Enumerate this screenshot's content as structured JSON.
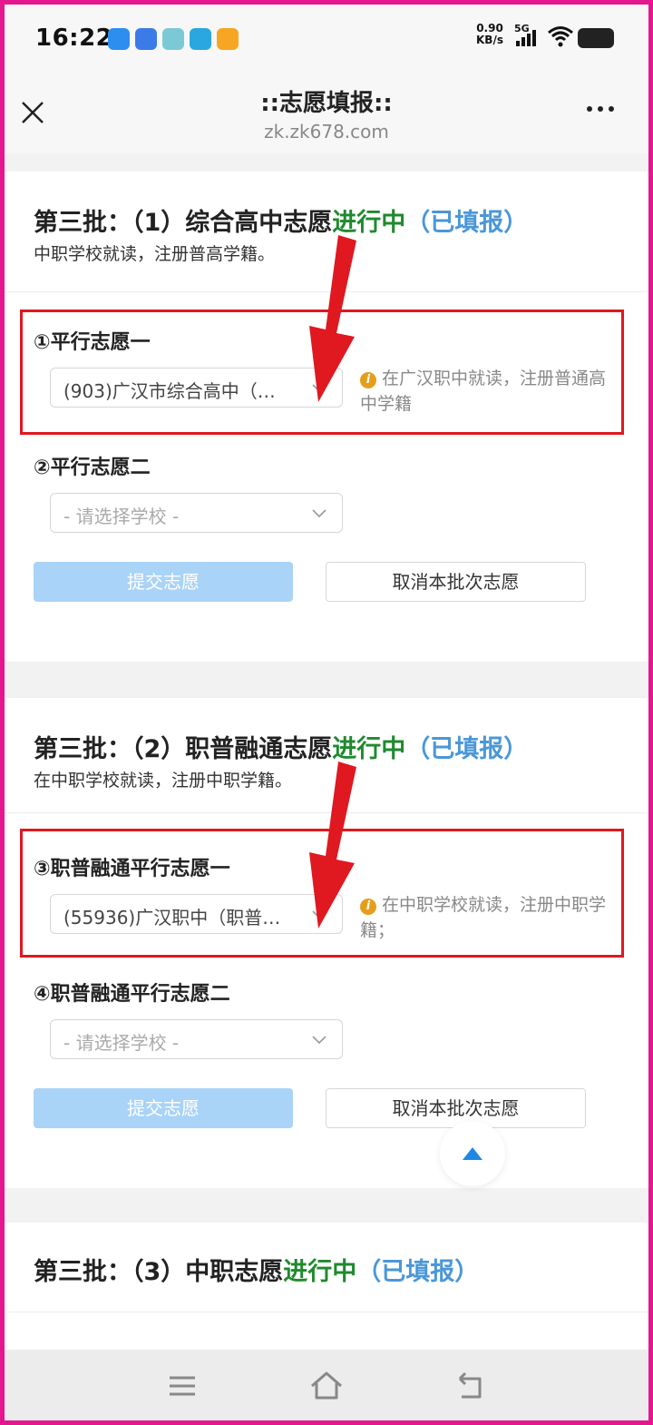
{
  "status": {
    "time": "16:22",
    "net_speed_value": "0.90",
    "net_speed_unit": "KB/s",
    "network": "5G",
    "app_icons": [
      {
        "name": "browser-app-icon",
        "color": "#2d8ef0"
      },
      {
        "name": "photo-app-icon",
        "color": "#3a7be8"
      },
      {
        "name": "gallery-app-icon",
        "color": "#7cc9d6"
      },
      {
        "name": "telegram-app-icon",
        "color": "#2aa7df"
      },
      {
        "name": "video-app-icon",
        "color": "#f6a623"
      }
    ]
  },
  "header": {
    "title": "::志愿填报::",
    "url": "zk.zk678.com"
  },
  "sections": [
    {
      "title": "第三批：（1）综合高中志愿",
      "status": "进行中",
      "filled": "（已填报）",
      "subtitle": "中职学校就读，注册普高学籍。",
      "field1_label": "①平行志愿一",
      "field1_value": "(903)广汉市综合高中（…",
      "field1_hint": "在广汉职中就读，注册普通高中学籍",
      "field2_label": "②平行志愿二",
      "field2_placeholder": "- 请选择学校 -",
      "submit_label": "提交志愿",
      "cancel_label": "取消本批次志愿"
    },
    {
      "title": "第三批：（2）职普融通志愿",
      "status": "进行中",
      "filled": "（已填报）",
      "subtitle": "在中职学校就读，注册中职学籍。",
      "field1_label": "③职普融通平行志愿一",
      "field1_value": "(55936)广汉职中（职普…",
      "field1_hint": "在中职学校就读，注册中职学籍；",
      "field2_label": "④职普融通平行志愿二",
      "field2_placeholder": "- 请选择学校 -",
      "submit_label": "提交志愿",
      "cancel_label": "取消本批次志愿"
    },
    {
      "title": "第三批：（3）中职志愿",
      "status": "进行中",
      "filled": "（已填报）"
    }
  ],
  "colors": {
    "status_green": "#1f8a2e",
    "filled_blue": "#4a97d8",
    "annotation_red": "#e0181f",
    "submit_disabled": "#a9d3f7",
    "frame_magenta": "#e4178f"
  }
}
